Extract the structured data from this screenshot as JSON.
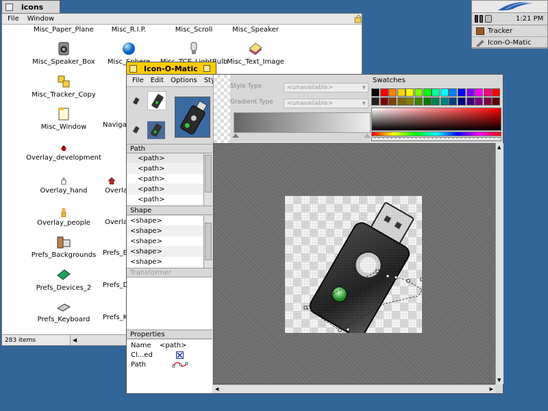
{
  "deskbar": {
    "time": "1:21 PM",
    "items": [
      {
        "label": "Tracker",
        "icon": "tracker-icon"
      },
      {
        "label": "Icon-O-Matic",
        "icon": "icon-o-matic-icon"
      }
    ]
  },
  "icons_window": {
    "title": "icons",
    "menu": [
      "File",
      "Window"
    ],
    "status": "283 items",
    "items": [
      "Misc_Paper_Plane",
      "Misc_R.I.P.",
      "Misc_Scroll",
      "Misc_Speaker",
      "Misc_Speaker_Box",
      "Misc_Sphere",
      "Misc_TCE_LightBulb",
      "Misc_Text_Image",
      "Misc_Tracker_Copy",
      "Misc_Window",
      "Navigati",
      "Overlay_development",
      "Overlay_hand",
      "Overla",
      "Overlay_people",
      "Overla",
      "Prefs_Backgrounds",
      "Prefs_B",
      "Prefs_Devices_2",
      "Prefs_D",
      "Prefs_Keyboard",
      "Prefs_K"
    ]
  },
  "iom": {
    "title": "Icon-O-Matic",
    "menu": [
      "File",
      "Edit",
      "Options",
      "Sty"
    ],
    "style_type_label": "Style Type",
    "style_type_value": "<unavailable>",
    "gradient_type_label": "Gradient Type",
    "gradient_type_value": "<unavailable>",
    "swatches_label": "Swatches",
    "path_label": "Path",
    "paths": [
      "<path>",
      "<path>",
      "<path>",
      "<path>",
      "<path>"
    ],
    "shape_label": "Shape",
    "shapes": [
      "<shape>",
      "<shape>",
      "<shape>",
      "<shape>",
      "<shape>"
    ],
    "transformer_label": "Transformer",
    "properties_label": "Properties",
    "properties": {
      "name_label": "Name",
      "name_value": "<path>",
      "closed_label": "Cl...ed",
      "path_label": "Path"
    },
    "swatch_colors": [
      [
        "#000000",
        "#ff0000",
        "#ff8000",
        "#ffd000",
        "#ffff00",
        "#80ff00",
        "#00ff00",
        "#00ffa0",
        "#00ffff",
        "#0080ff",
        "#0000ff",
        "#8000ff",
        "#ff00ff",
        "#ff0080",
        "#ff0000"
      ],
      [
        "#202020",
        "#800000",
        "#804000",
        "#806800",
        "#808000",
        "#408000",
        "#008000",
        "#008050",
        "#008080",
        "#004080",
        "#000080",
        "#400080",
        "#800080",
        "#800040",
        "#600000"
      ]
    ]
  }
}
